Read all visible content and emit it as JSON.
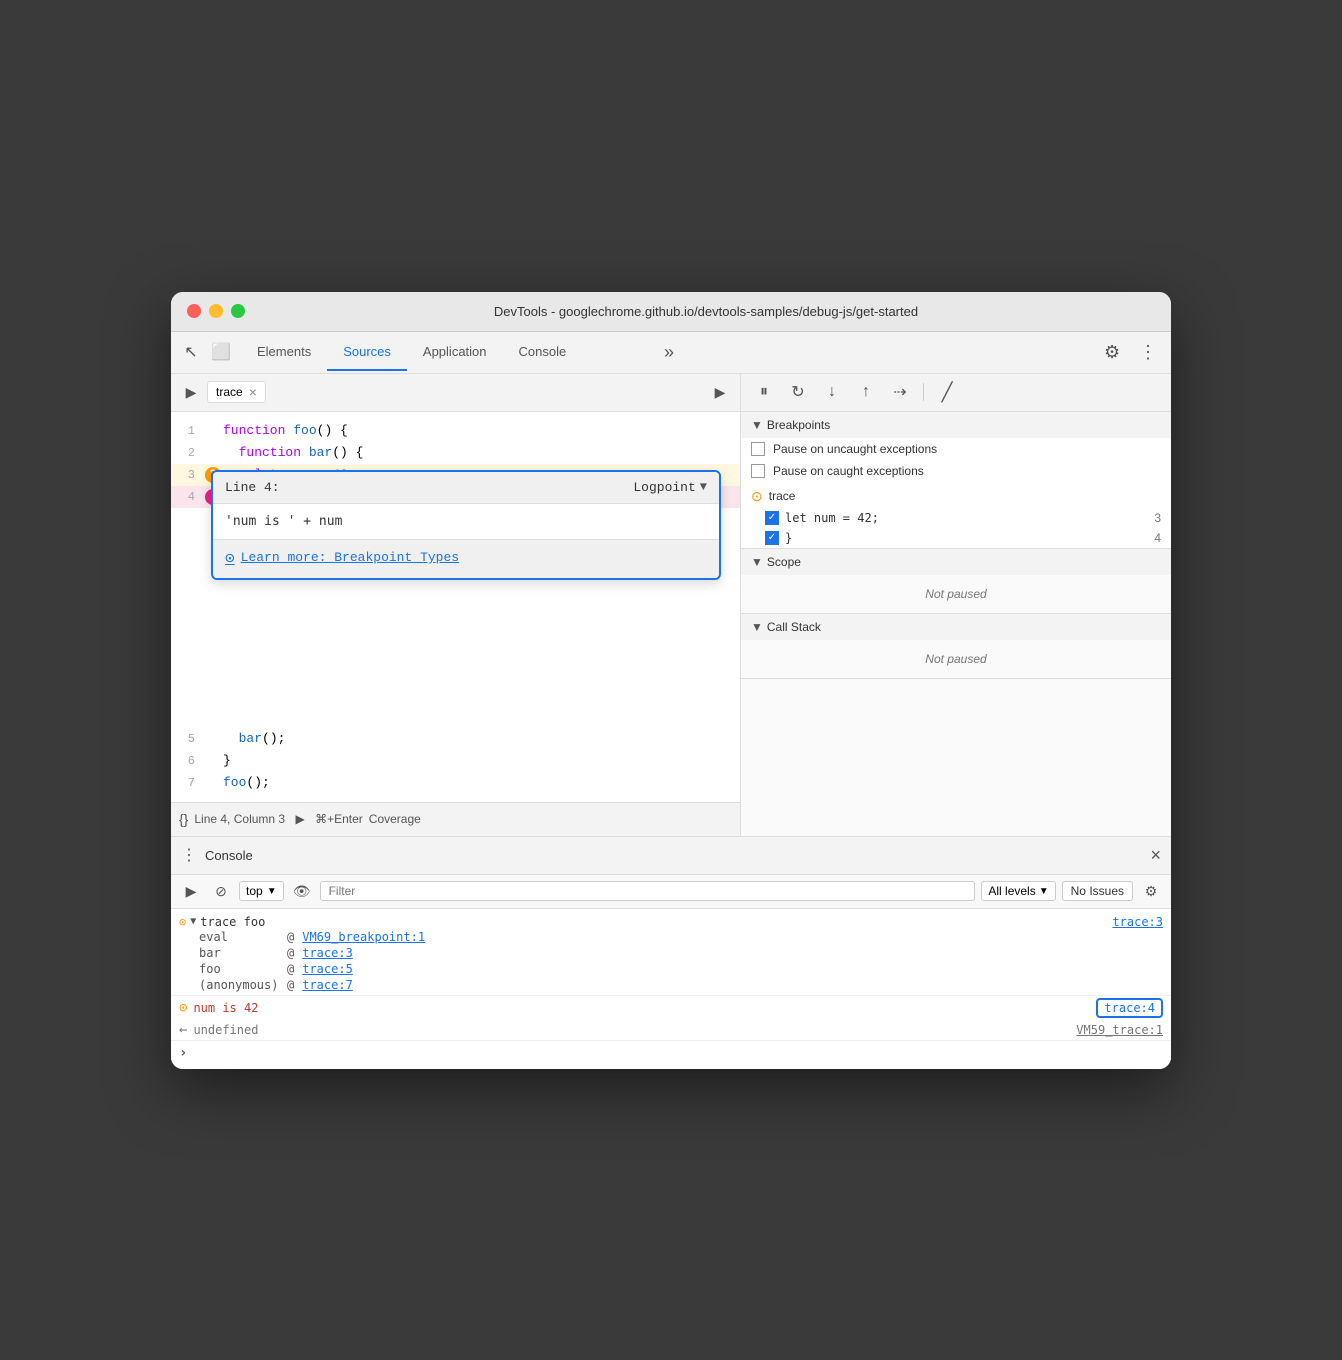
{
  "window": {
    "title": "DevTools - googlechrome.github.io/devtools-samples/debug-js/get-started",
    "traffic_lights": [
      "red",
      "yellow",
      "green"
    ]
  },
  "topbar": {
    "tabs": [
      {
        "label": "Elements",
        "active": false
      },
      {
        "label": "Sources",
        "active": true
      },
      {
        "label": "Application",
        "active": false
      },
      {
        "label": "Console",
        "active": false
      }
    ],
    "more_label": "»"
  },
  "sources": {
    "file_tab": "trace",
    "close_label": "×",
    "code_lines": [
      {
        "num": "1",
        "content": "function foo() {",
        "marker": null
      },
      {
        "num": "2",
        "content": "    function bar() {",
        "marker": null
      },
      {
        "num": "3",
        "content": "        let num = 42;",
        "marker": "orange"
      },
      {
        "num": "4",
        "content": "    }",
        "marker": "pink"
      },
      {
        "num": "5",
        "content": "    bar();",
        "marker": null
      },
      {
        "num": "6",
        "content": "}",
        "marker": null
      },
      {
        "num": "7",
        "content": "foo();",
        "marker": null
      }
    ]
  },
  "logpoint": {
    "line_label": "Line 4:",
    "type": "Logpoint",
    "expression": "'num is ' + num",
    "learn_more": "Learn more: Breakpoint Types"
  },
  "status_bar": {
    "position": "Line 4, Column 3",
    "run_label": "⌘+Enter",
    "coverage": "Coverage"
  },
  "debug_toolbar": {
    "buttons": [
      "pause",
      "step-over",
      "step-into",
      "step-out",
      "continue",
      "deactivate"
    ]
  },
  "breakpoints": {
    "title": "Breakpoints",
    "pause_uncaught": "Pause on uncaught exceptions",
    "pause_caught": "Pause on caught exceptions",
    "items": [
      {
        "filename": "trace",
        "code": "let num = 42;",
        "line": "3"
      },
      {
        "filename": "",
        "code": "}",
        "line": "4"
      }
    ]
  },
  "scope": {
    "title": "Scope",
    "content": "Not paused"
  },
  "callstack": {
    "title": "Call Stack",
    "content": "Not paused"
  },
  "console": {
    "title": "Console",
    "toolbar": {
      "context_text": "top",
      "filter_placeholder": "Filter",
      "levels": "All levels",
      "issues": "No Issues"
    },
    "entries": [
      {
        "type": "trace-group",
        "icon": "▶",
        "label": "trace foo",
        "ref": "trace:3",
        "stack": [
          {
            "label": "eval",
            "at": "VM69_breakpoint:1",
            "link": true
          },
          {
            "label": "bar",
            "at": "trace:3",
            "link": true
          },
          {
            "label": "foo",
            "at": "trace:5",
            "link": true
          },
          {
            "label": "(anonymous)",
            "at": "trace:7",
            "link": true
          }
        ]
      },
      {
        "type": "output",
        "icon": "⊙",
        "text": "num is 42",
        "ref": "trace:4",
        "highlighted_ref": true
      },
      {
        "type": "output",
        "icon": "←",
        "text": "undefined",
        "ref": "VM59_trace:1"
      }
    ],
    "input_prompt": ">"
  }
}
